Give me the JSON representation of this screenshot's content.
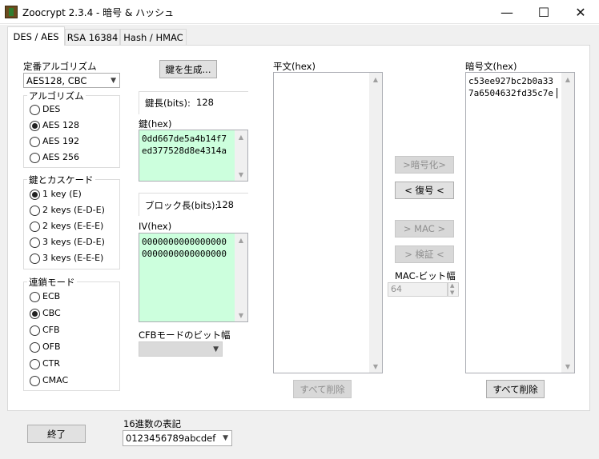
{
  "window": {
    "title": "Zoocrypt 2.3.4 - 暗号 & ハッシュ",
    "controls": {
      "minimize": "—",
      "maximize": "☐",
      "close": "✕"
    }
  },
  "tabs": [
    {
      "label": "DES / AES",
      "active": true
    },
    {
      "label": "RSA 16384",
      "active": false
    },
    {
      "label": "Hash / HMAC",
      "active": false
    }
  ],
  "preset": {
    "label": "定番アルゴリズム",
    "value": "AES128, CBC"
  },
  "algorithm_group": {
    "title": "アルゴリズム",
    "options": [
      {
        "label": "DES",
        "selected": false
      },
      {
        "label": "AES 128",
        "selected": true
      },
      {
        "label": "AES 192",
        "selected": false
      },
      {
        "label": "AES 256",
        "selected": false
      }
    ]
  },
  "cascade_group": {
    "title": "鍵とカスケード",
    "options": [
      {
        "label": "1 key  (E)",
        "selected": true
      },
      {
        "label": "2 keys (E-D-E)",
        "selected": false
      },
      {
        "label": "2 keys (E-E-E)",
        "selected": false
      },
      {
        "label": "3 keys (E-D-E)",
        "selected": false
      },
      {
        "label": "3 keys (E-E-E)",
        "selected": false
      }
    ]
  },
  "chain_group": {
    "title": "連鎖モード",
    "options": [
      {
        "label": "ECB",
        "selected": false
      },
      {
        "label": "CBC",
        "selected": true
      },
      {
        "label": "CFB",
        "selected": false
      },
      {
        "label": "OFB",
        "selected": false
      },
      {
        "label": "CTR",
        "selected": false
      },
      {
        "label": "CMAC",
        "selected": false
      }
    ]
  },
  "key": {
    "generate_button": "鍵を生成...",
    "length_label": "鍵長(bits):",
    "length_value": "128",
    "hex_label": "鍵(hex)",
    "hex_line1": "0dd667de5a4b14f7",
    "hex_line2": "ed377528d8e4314a"
  },
  "iv": {
    "block_label": "ブロック長(bits):",
    "block_value": "128",
    "hex_label": "IV(hex)",
    "hex_line1": "0000000000000000",
    "hex_line2": "0000000000000000"
  },
  "cfb": {
    "label": "CFBモードのビット幅",
    "value": ""
  },
  "plaintext": {
    "label": "平文(hex)",
    "value": "",
    "clear_button": "すべて削除"
  },
  "ciphertext": {
    "label": "暗号文(hex)",
    "line1": "c53ee927bc2b0a33",
    "line2": "7a6504632fd35c7e",
    "clear_button": "すべて削除"
  },
  "actions": {
    "encrypt": ">暗号化>",
    "decrypt": "< 復号 <",
    "mac": "> MAC >",
    "verify": "> 検証 <",
    "mac_bits_label": "MAC-ビット幅",
    "mac_bits_value": "64"
  },
  "footer": {
    "exit_button": "終了",
    "hex_format_label": "16進数の表記",
    "hex_format_value": "0123456789abcdef"
  }
}
